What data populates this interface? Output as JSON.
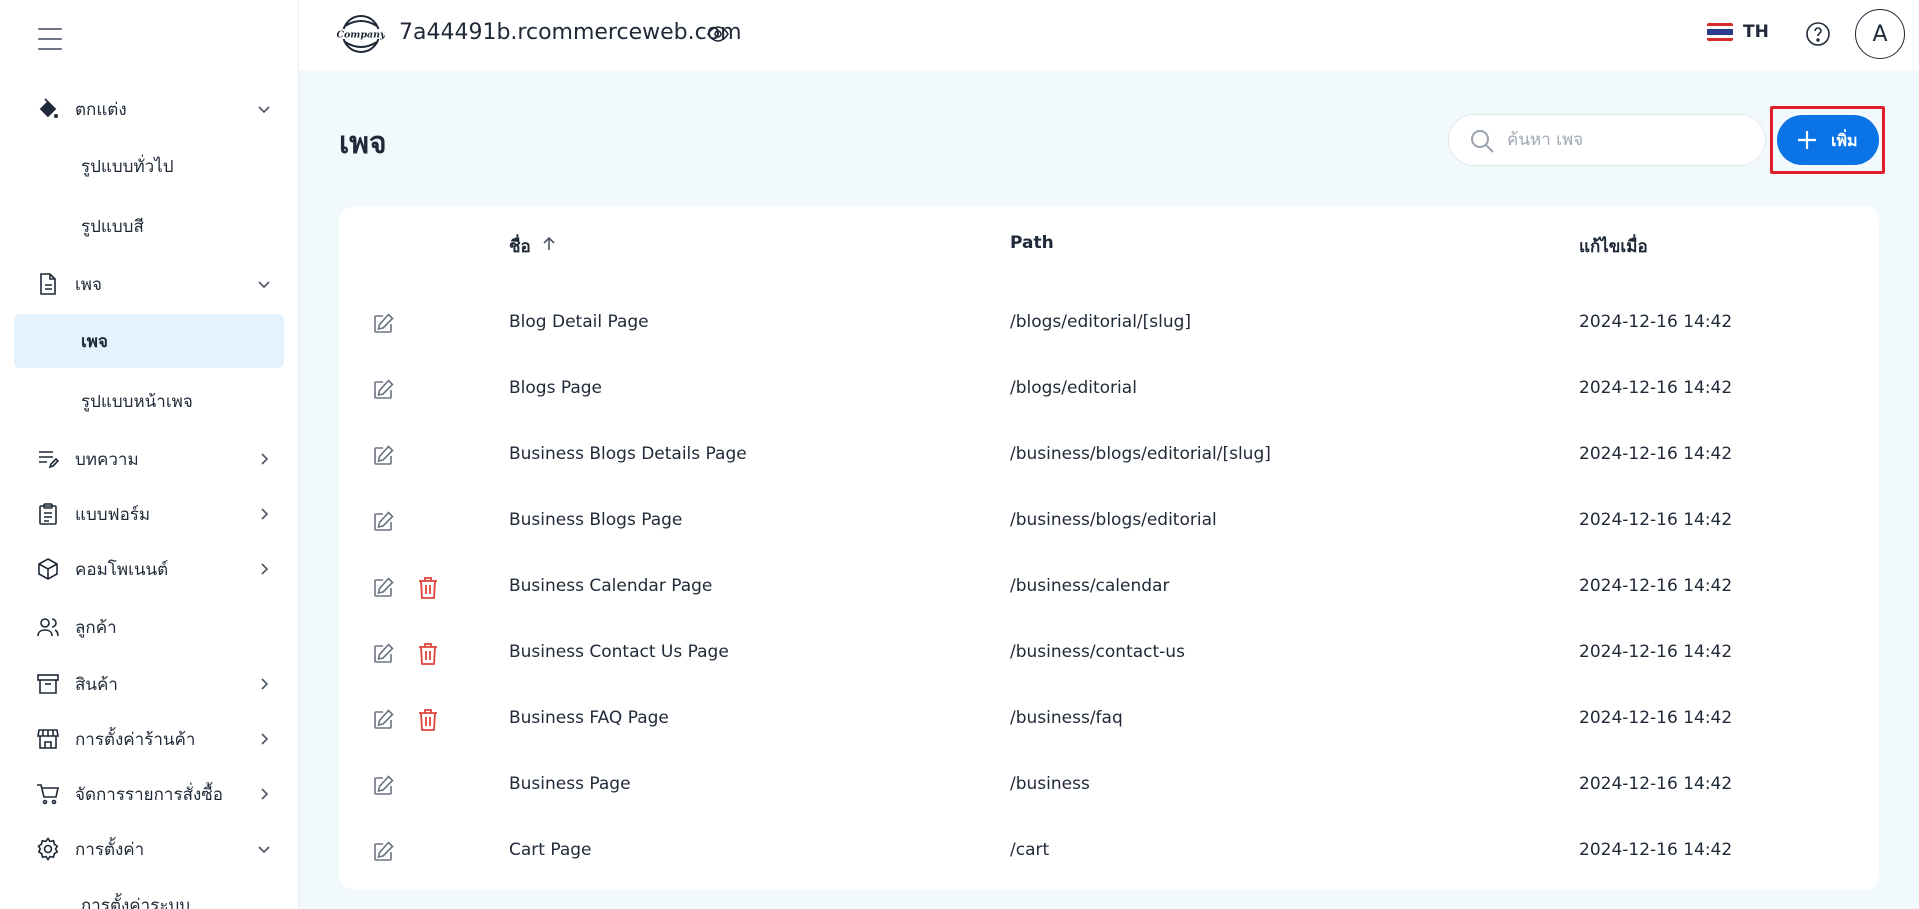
{
  "topbar": {
    "site_url": "7a44491b.rcommerceweb.com",
    "logo_text": "Company",
    "lang": "TH",
    "avatar": "A"
  },
  "sidebar": {
    "groups": [
      {
        "label": "ตกแต่ง",
        "icon": "paint-bucket-icon",
        "chevron": "down"
      },
      {
        "label": "เพจ",
        "icon": "document-icon",
        "chevron": "down"
      },
      {
        "label": "บทความ",
        "icon": "edit-list-icon",
        "chevron": "right"
      },
      {
        "label": "แบบฟอร์ม",
        "icon": "clipboard-icon",
        "chevron": "right"
      },
      {
        "label": "คอมโพเนนต์",
        "icon": "cube-icon",
        "chevron": "right"
      },
      {
        "label": "ลูกค้า",
        "icon": "users-icon"
      },
      {
        "label": "สินค้า",
        "icon": "box-icon",
        "chevron": "right"
      },
      {
        "label": "การตั้งค่าร้านค้า",
        "icon": "store-icon",
        "chevron": "right"
      },
      {
        "label": "จัดการรายการสั่งซื้อ",
        "icon": "cart-icon",
        "chevron": "right"
      },
      {
        "label": "การตั้งค่า",
        "icon": "gear-icon",
        "chevron": "down"
      }
    ],
    "sub_items": [
      {
        "label": "รูปแบบทั่วไป"
      },
      {
        "label": "รูปแบบสี"
      },
      {
        "label": "เพจ",
        "active": true
      },
      {
        "label": "รูปแบบหน้าเพจ"
      },
      {
        "label": "การตั้งค่าระบบ"
      }
    ]
  },
  "main": {
    "title": "เพจ",
    "search_placeholder": "ค้นหา เพจ",
    "add_label": "เพิ่ม",
    "columns": {
      "name": "ชื่อ",
      "path": "Path",
      "modified": "แก้ไขเมื่อ"
    },
    "rows": [
      {
        "name": "Blog Detail Page",
        "path": "/blogs/editorial/[slug]",
        "modified": "2024-12-16 14:42",
        "deletable": false
      },
      {
        "name": "Blogs Page",
        "path": "/blogs/editorial",
        "modified": "2024-12-16 14:42",
        "deletable": false
      },
      {
        "name": "Business Blogs Details Page",
        "path": "/business/blogs/editorial/[slug]",
        "modified": "2024-12-16 14:42",
        "deletable": false
      },
      {
        "name": "Business Blogs Page",
        "path": "/business/blogs/editorial",
        "modified": "2024-12-16 14:42",
        "deletable": false
      },
      {
        "name": "Business Calendar Page",
        "path": "/business/calendar",
        "modified": "2024-12-16 14:42",
        "deletable": true
      },
      {
        "name": "Business Contact Us Page",
        "path": "/business/contact-us",
        "modified": "2024-12-16 14:42",
        "deletable": true
      },
      {
        "name": "Business FAQ Page",
        "path": "/business/faq",
        "modified": "2024-12-16 14:42",
        "deletable": true
      },
      {
        "name": "Business Page",
        "path": "/business",
        "modified": "2024-12-16 14:42",
        "deletable": false
      },
      {
        "name": "Cart Page",
        "path": "/cart",
        "modified": "2024-12-16 14:42",
        "deletable": false
      }
    ]
  },
  "colors": {
    "accent": "#0a74e6",
    "highlight_frame": "#e11d2a",
    "delete": "#e0433b",
    "active_bg": "#e3f2fc"
  }
}
